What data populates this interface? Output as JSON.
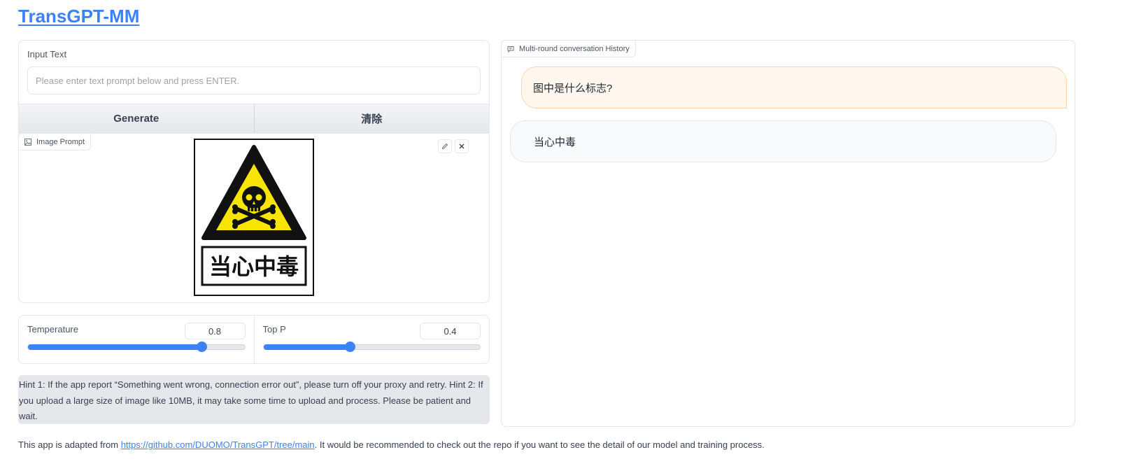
{
  "app": {
    "title": "TransGPT-MM"
  },
  "input": {
    "label": "Input Text",
    "placeholder": "Please enter text prompt below and press ENTER.",
    "value": ""
  },
  "buttons": {
    "generate": "Generate",
    "clear": "清除"
  },
  "image_prompt": {
    "label": "Image Prompt",
    "edit_icon": "pencil-icon",
    "close_icon": "close-icon",
    "sign_text": "当心中毒"
  },
  "sliders": {
    "temperature": {
      "label": "Temperature",
      "value": "0.8",
      "fraction": 0.8
    },
    "top_p": {
      "label": "Top P",
      "value": "0.4",
      "fraction": 0.4
    }
  },
  "hint": "Hint 1: If the app report “Something went wrong, connection error out”, please turn off your proxy and retry. Hint 2: If you upload a large size of image like 10MB, it may take some time to upload and process. Please be patient and wait.",
  "footer": {
    "prefix": "This app is adapted from ",
    "link": "https://github.com/DUOMO/TransGPT/tree/main",
    "suffix": ". It would be recommended to check out the repo if you want to see the detail of our model and training process."
  },
  "chat": {
    "label": "Multi-round conversation History",
    "messages": [
      {
        "role": "user",
        "text": "图中是什么标志?"
      },
      {
        "role": "bot",
        "text": "当心中毒"
      }
    ]
  },
  "colors": {
    "accent": "#3b82f6",
    "user_bubble": "#fff7ed",
    "bot_bubble": "#f9fafb",
    "sign_yellow": "#f7e400"
  }
}
